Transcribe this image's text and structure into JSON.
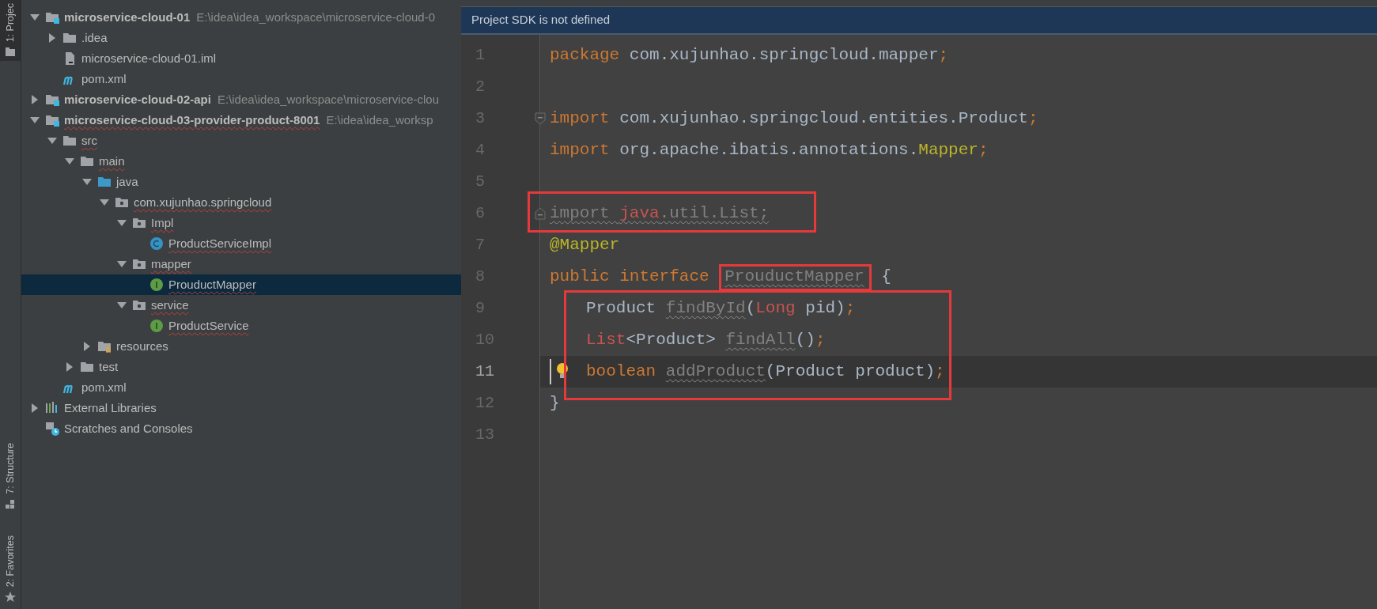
{
  "tool_strip": [
    {
      "label": "1: Projec",
      "kind": "project",
      "selected": true
    },
    {
      "label": "7: Structure",
      "kind": "structure",
      "selected": false
    },
    {
      "label": "2: Favorites",
      "kind": "favorites",
      "selected": false
    }
  ],
  "project_tree": [
    {
      "label": "microservice-cloud-01",
      "path": "E:\\idea\\idea_workspace\\microservice-cloud-0",
      "kind": "module",
      "bold": true,
      "expanded": true,
      "error": false,
      "selected": false,
      "children": [
        {
          "label": ".idea",
          "kind": "folder",
          "expanded": false,
          "error": false,
          "selected": false
        },
        {
          "label": "microservice-cloud-01.iml",
          "kind": "iml",
          "error": false,
          "selected": false
        },
        {
          "label": "pom.xml",
          "kind": "maven",
          "error": false,
          "selected": false
        }
      ]
    },
    {
      "label": "microservice-cloud-02-api",
      "path": "E:\\idea\\idea_workspace\\microservice-clou",
      "kind": "module",
      "bold": true,
      "expanded": false,
      "error": false,
      "selected": false
    },
    {
      "label": "microservice-cloud-03-provider-product-8001",
      "path": "E:\\idea\\idea_worksp",
      "kind": "module",
      "bold": true,
      "expanded": true,
      "error": true,
      "selected": false,
      "children": [
        {
          "label": "src",
          "kind": "folder",
          "expanded": true,
          "error": true,
          "selected": false,
          "children": [
            {
              "label": "main",
              "kind": "folder",
              "expanded": true,
              "error": true,
              "selected": false,
              "children": [
                {
                  "label": "java",
                  "kind": "source",
                  "expanded": true,
                  "error": false,
                  "selected": false,
                  "children": [
                    {
                      "label": "com.xujunhao.springcloud",
                      "kind": "package",
                      "expanded": true,
                      "error": true,
                      "selected": false,
                      "children": [
                        {
                          "label": "Impl",
                          "kind": "package",
                          "expanded": true,
                          "error": true,
                          "selected": false,
                          "children": [
                            {
                              "label": "ProductServiceImpl",
                              "kind": "class",
                              "error": true,
                              "selected": false
                            }
                          ]
                        },
                        {
                          "label": "mapper",
                          "kind": "package",
                          "expanded": true,
                          "error": true,
                          "selected": false,
                          "children": [
                            {
                              "label": "ProuductMapper",
                              "kind": "interface",
                              "error": true,
                              "selected": true
                            }
                          ]
                        },
                        {
                          "label": "service",
                          "kind": "package",
                          "expanded": true,
                          "error": true,
                          "selected": false,
                          "children": [
                            {
                              "label": "ProductService",
                              "kind": "interface",
                              "error": true,
                              "selected": false
                            }
                          ]
                        }
                      ]
                    }
                  ]
                },
                {
                  "label": "resources",
                  "kind": "resources",
                  "expanded": false,
                  "error": false,
                  "selected": false
                }
              ]
            },
            {
              "label": "test",
              "kind": "folder",
              "expanded": false,
              "error": false,
              "selected": false
            }
          ]
        },
        {
          "label": "pom.xml",
          "kind": "maven",
          "error": false,
          "selected": false
        }
      ]
    },
    {
      "label": "External Libraries",
      "kind": "libraries",
      "expanded": false,
      "error": false,
      "selected": false
    },
    {
      "label": "Scratches and Consoles",
      "kind": "scratches",
      "error": false,
      "selected": false
    }
  ],
  "editor": {
    "banner": "Project SDK is not defined",
    "lines": [
      {
        "number": "1",
        "current": false,
        "tokens": [
          {
            "text": "package ",
            "kind": "keyword"
          },
          {
            "text": "com.xujunhao.springcloud.mapper",
            "kind": "plain"
          },
          {
            "text": ";",
            "kind": "keyword"
          }
        ]
      },
      {
        "number": "2",
        "current": false
      },
      {
        "number": "3",
        "current": false,
        "fold_open": true,
        "tokens": [
          {
            "text": "import ",
            "kind": "keyword"
          },
          {
            "text": "com.xujunhao.springcloud.entities.Product",
            "kind": "plain"
          },
          {
            "text": ";",
            "kind": "keyword"
          }
        ]
      },
      {
        "number": "4",
        "current": false,
        "tokens": [
          {
            "text": "import ",
            "kind": "keyword"
          },
          {
            "text": "org.apache.ibatis.annotations.",
            "kind": "plain"
          },
          {
            "text": "Mapper",
            "kind": "annotation"
          },
          {
            "text": ";",
            "kind": "keyword"
          }
        ]
      },
      {
        "number": "5",
        "current": false
      },
      {
        "number": "6",
        "current": false,
        "boxed": true,
        "fold_close": true,
        "tokens": [
          {
            "text": "import ",
            "kind": "unused",
            "warning": true
          },
          {
            "text": "java",
            "kind": "unresolved",
            "warning": true
          },
          {
            "text": ".util.List;",
            "kind": "unused",
            "warning": true
          }
        ]
      },
      {
        "number": "7",
        "current": false,
        "tokens": [
          {
            "text": "@Mapper",
            "kind": "annotation"
          }
        ]
      },
      {
        "number": "8",
        "current": false,
        "tokens": [
          {
            "text": "public interface ",
            "kind": "keyword"
          },
          {
            "text": "ProuductMapper",
            "kind": "unused",
            "warning": true,
            "boxed": true
          },
          {
            "text": " {",
            "kind": "plain"
          }
        ]
      },
      {
        "number": "9",
        "current": false,
        "boxed": true,
        "indented": true,
        "tokens": [
          {
            "text": "Product ",
            "kind": "plain"
          },
          {
            "text": "findById",
            "kind": "unused",
            "warning": true
          },
          {
            "text": "(",
            "kind": "plain"
          },
          {
            "text": "Long",
            "kind": "unresolved"
          },
          {
            "text": " pid)",
            "kind": "plain"
          },
          {
            "text": ";",
            "kind": "keyword"
          }
        ]
      },
      {
        "number": "10",
        "current": false,
        "boxed": true,
        "indented": true,
        "tokens": [
          {
            "text": "List",
            "kind": "unresolved"
          },
          {
            "text": "<Product> ",
            "kind": "plain"
          },
          {
            "text": "findAll",
            "kind": "unused",
            "warning": true
          },
          {
            "text": "()",
            "kind": "plain"
          },
          {
            "text": ";",
            "kind": "keyword"
          }
        ]
      },
      {
        "number": "11",
        "current": true,
        "boxed": true,
        "indented": true,
        "tokens": [
          {
            "text": "boolean ",
            "kind": "keyword"
          },
          {
            "text": "addProduct",
            "kind": "unused",
            "warning": true
          },
          {
            "text": "(Product product)",
            "kind": "plain"
          },
          {
            "text": ";",
            "kind": "keyword"
          }
        ]
      },
      {
        "number": "12",
        "current": false,
        "tokens": [
          {
            "text": "}",
            "kind": "plain"
          }
        ]
      },
      {
        "number": "13",
        "current": false
      }
    ]
  }
}
